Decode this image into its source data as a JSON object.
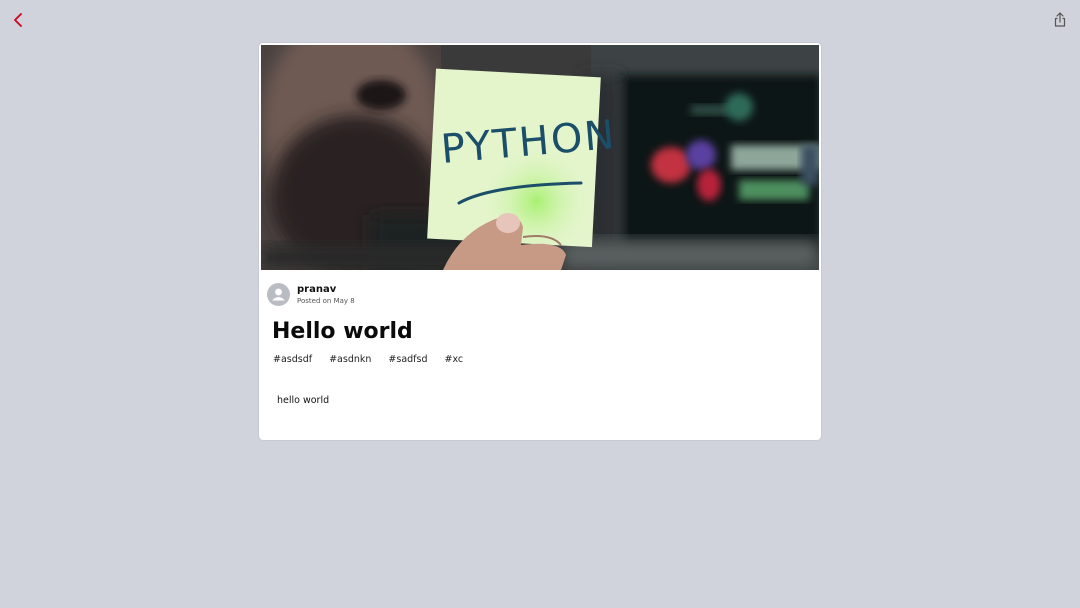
{
  "nav": {
    "back_icon": "chevron-left-icon",
    "share_icon": "share-icon",
    "accent_color": "#d0021b"
  },
  "post": {
    "cover_image_text": "PYTHON",
    "author": {
      "name": "pranav",
      "posted": "Posted on May 8"
    },
    "title": "Hello world",
    "tags": [
      "#asdsdf",
      "#asdnkn",
      "#sadfsd",
      "#xc"
    ],
    "body": "hello world"
  }
}
